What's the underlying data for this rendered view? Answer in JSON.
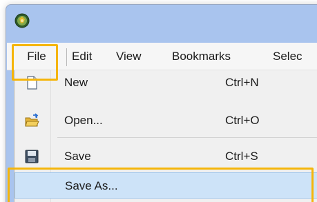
{
  "menubar": {
    "items": [
      {
        "label": "File"
      },
      {
        "label": "Edit"
      },
      {
        "label": "View"
      },
      {
        "label": "Bookmarks"
      },
      {
        "label": "Selec"
      }
    ]
  },
  "file_menu": {
    "items": [
      {
        "label": "New",
        "shortcut": "Ctrl+N",
        "icon": "new-document-icon"
      },
      {
        "label": "Open...",
        "shortcut": "Ctrl+O",
        "icon": "open-folder-icon"
      },
      {
        "label": "Save",
        "shortcut": "Ctrl+S",
        "icon": "floppy-disk-icon"
      },
      {
        "label": "Save As...",
        "shortcut": "",
        "icon": ""
      }
    ]
  },
  "colors": {
    "highlight_outline": "#f5b50a",
    "hover_background": "#cde3f8",
    "titlebar": "#a9c4ee"
  }
}
